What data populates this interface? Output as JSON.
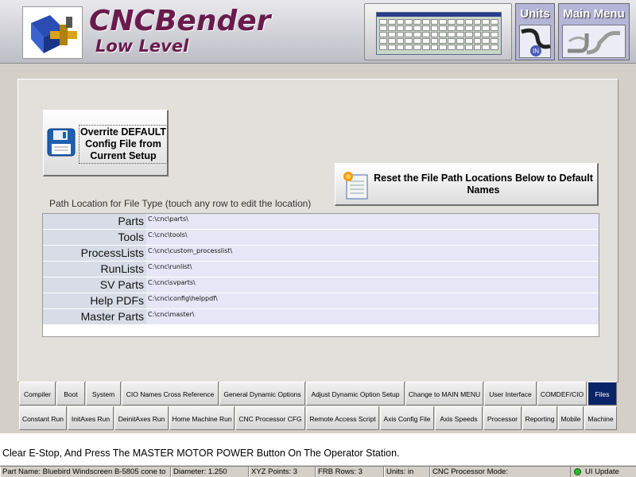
{
  "header": {
    "title": "CNCBender",
    "subtitle": "Low Level",
    "units_label": "Units",
    "units_badge": "IN",
    "main_menu_label": "Main Menu"
  },
  "actions": {
    "overwrite_lines": [
      "Overrite DEFAULT",
      "Config File from",
      "Current Setup"
    ],
    "reset_lines": [
      "Reset the File Path Locations Below to Default",
      "Names"
    ]
  },
  "paths": {
    "caption": "Path Location for File Type (touch any row to edit the location)",
    "rows": [
      {
        "type": "Parts",
        "value": "C:\\cnc\\parts\\"
      },
      {
        "type": "Tools",
        "value": "C:\\cnc\\tools\\"
      },
      {
        "type": "ProcessLists",
        "value": "C:\\cnc\\custom_processlist\\"
      },
      {
        "type": "RunLists",
        "value": "C:\\cnc\\runlist\\"
      },
      {
        "type": "SV Parts",
        "value": "C:\\cnc\\svparts\\"
      },
      {
        "type": "Help PDFs",
        "value": "C:\\cnc\\config\\helppdf\\"
      },
      {
        "type": "Master Parts",
        "value": "C:\\cnc\\master\\"
      }
    ]
  },
  "tabs": {
    "row1": [
      "Compiler",
      "Boot",
      "System",
      "CIO Names Cross Reference",
      "General Dynamic Options",
      "Adjust Dynamic Option Setup",
      "Change to MAIN MENU",
      "User Interface",
      "COMDEF/CIO",
      "Files"
    ],
    "row2": [
      "Constant Run",
      "InitAxes Run",
      "DeinitAxes Run",
      "Home Machine Run",
      "CNC Processor CFG",
      "Remote Access Script",
      "Axis Config File",
      "Axis Speeds",
      "Processor",
      "Reporting",
      "Mobile",
      "Machine"
    ],
    "active": "Files"
  },
  "message": "Clear E-Stop, And Press The MASTER MOTOR POWER Button On The Operator Station.",
  "status": {
    "part_name": "Part Name: Bluebird Windscreen B-5805 cone to",
    "diameter": "Diameter: 1.250",
    "xyz_points": "XYZ Points: 3",
    "frb_rows": "FRB Rows: 3",
    "units": "Units: in",
    "processor_mode": "CNC Processor Mode:",
    "ui_update": "UI Update"
  },
  "colors": {
    "title": "#6a1b4d",
    "tab_active": "#0a246a",
    "path_type_bg": "#d8dce6",
    "path_value_bg": "#e6e6f6",
    "status_ok": "#27c227"
  }
}
